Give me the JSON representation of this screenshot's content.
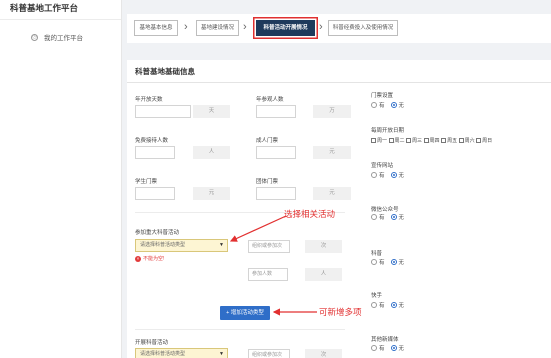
{
  "sidebar": {
    "brand": "科普基地工作平台",
    "items": [
      {
        "label": "我的工作平台"
      }
    ]
  },
  "steps": [
    {
      "label": "基地基本信息"
    },
    {
      "label": "基地建设情况"
    },
    {
      "label": "科普活动开展情况"
    },
    {
      "label": "科普经费投入及使用情况"
    }
  ],
  "panel": {
    "title": "科普基地基础信息",
    "left": {
      "open_days": {
        "label": "年开放天数",
        "unit": "天"
      },
      "free_reception": {
        "label": "免费接待人数",
        "unit": "人"
      },
      "student_ticket": {
        "label": "学生门票",
        "unit": "元"
      },
      "activity": {
        "label": "参加重大科普活动",
        "select_placeholder": "请选择科普活动类型",
        "error": "不能为空!",
        "times_placeholder": "组织或参加次",
        "times_unit": "次",
        "people_placeholder": "参加人数",
        "people_unit": "人",
        "add_button": "+ 增加活动类型"
      },
      "activity2": {
        "label": "开展科普活动",
        "select_placeholder": "请选择科普活动类型",
        "times_placeholder": "组织或参加次",
        "times_unit": "次"
      }
    },
    "mid": {
      "annual_visitors": {
        "label": "年参观人数",
        "unit": "万"
      },
      "adult_ticket": {
        "label": "成人门票",
        "unit": "元"
      },
      "group_ticket": {
        "label": "团体门票",
        "unit": "元"
      }
    },
    "right": {
      "ticket_setting": {
        "label": "门票设置",
        "opt_yes": "有",
        "opt_no": "无",
        "selected": "无"
      },
      "weekly_open": {
        "label": "每周开放日期",
        "days": [
          "周一",
          "周二",
          "周三",
          "周四",
          "周五",
          "周六",
          "周日"
        ]
      },
      "website": {
        "label": "宣传网站",
        "opt_yes": "有",
        "opt_no": "无",
        "selected": "无"
      },
      "wechat": {
        "label": "微信公众号",
        "opt_yes": "有",
        "opt_no": "无",
        "selected": "无"
      },
      "weibo": {
        "label": "科普",
        "opt_yes": "有",
        "opt_no": "无",
        "selected": "无"
      },
      "kuaishou": {
        "label": "快手",
        "opt_yes": "有",
        "opt_no": "无",
        "selected": "无"
      },
      "other_media": {
        "label": "其他新媒体",
        "opt_yes": "有",
        "opt_no": "无",
        "selected": "无"
      }
    }
  },
  "annotations": {
    "select_hint": "选择相关活动",
    "add_hint": "可新增多项"
  },
  "colors": {
    "accent": "#2f6ec8",
    "active_step": "#1e3a5c",
    "annotation": "#e23030",
    "select_bg": "#fdf5d3"
  }
}
